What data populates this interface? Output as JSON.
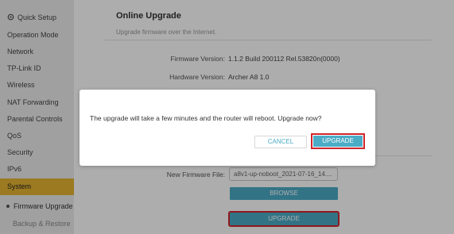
{
  "sidebar": {
    "items": [
      {
        "label": "Quick Setup",
        "icon": "gear-icon"
      },
      {
        "label": "Operation Mode"
      },
      {
        "label": "Network"
      },
      {
        "label": "TP-Link ID"
      },
      {
        "label": "Wireless"
      },
      {
        "label": "NAT Forwarding"
      },
      {
        "label": "Parental Controls"
      },
      {
        "label": "QoS"
      },
      {
        "label": "Security"
      },
      {
        "label": "IPv6"
      },
      {
        "label": "System",
        "active": true
      }
    ],
    "subitems": [
      {
        "label": "Firmware Upgrade",
        "selected": true
      },
      {
        "label": "Backup & Restore"
      }
    ],
    "active_color": "#e5b432"
  },
  "main": {
    "title": "Online Upgrade",
    "subtitle": "Upgrade firmware over the Internet.",
    "firmware_version_label": "Firmware Version:",
    "firmware_version_value": "1.1.2 Build 200112 Rel.53820n(0000)",
    "hardware_version_label": "Hardware Version:",
    "hardware_version_value": "Archer A8 1.0",
    "new_firmware_label": "New Firmware File:",
    "new_firmware_value": "a8v1-up-noboot_2021-07-16_14....",
    "browse_label": "BROWSE",
    "upgrade_label": "UPGRADE"
  },
  "dialog": {
    "message": "The upgrade will take a few minutes and the router will reboot. Upgrade now?",
    "cancel_label": "CANCEL",
    "upgrade_label": "UPGRADE"
  },
  "colors": {
    "accent": "#4bacc6",
    "highlight": "#d0262b"
  }
}
